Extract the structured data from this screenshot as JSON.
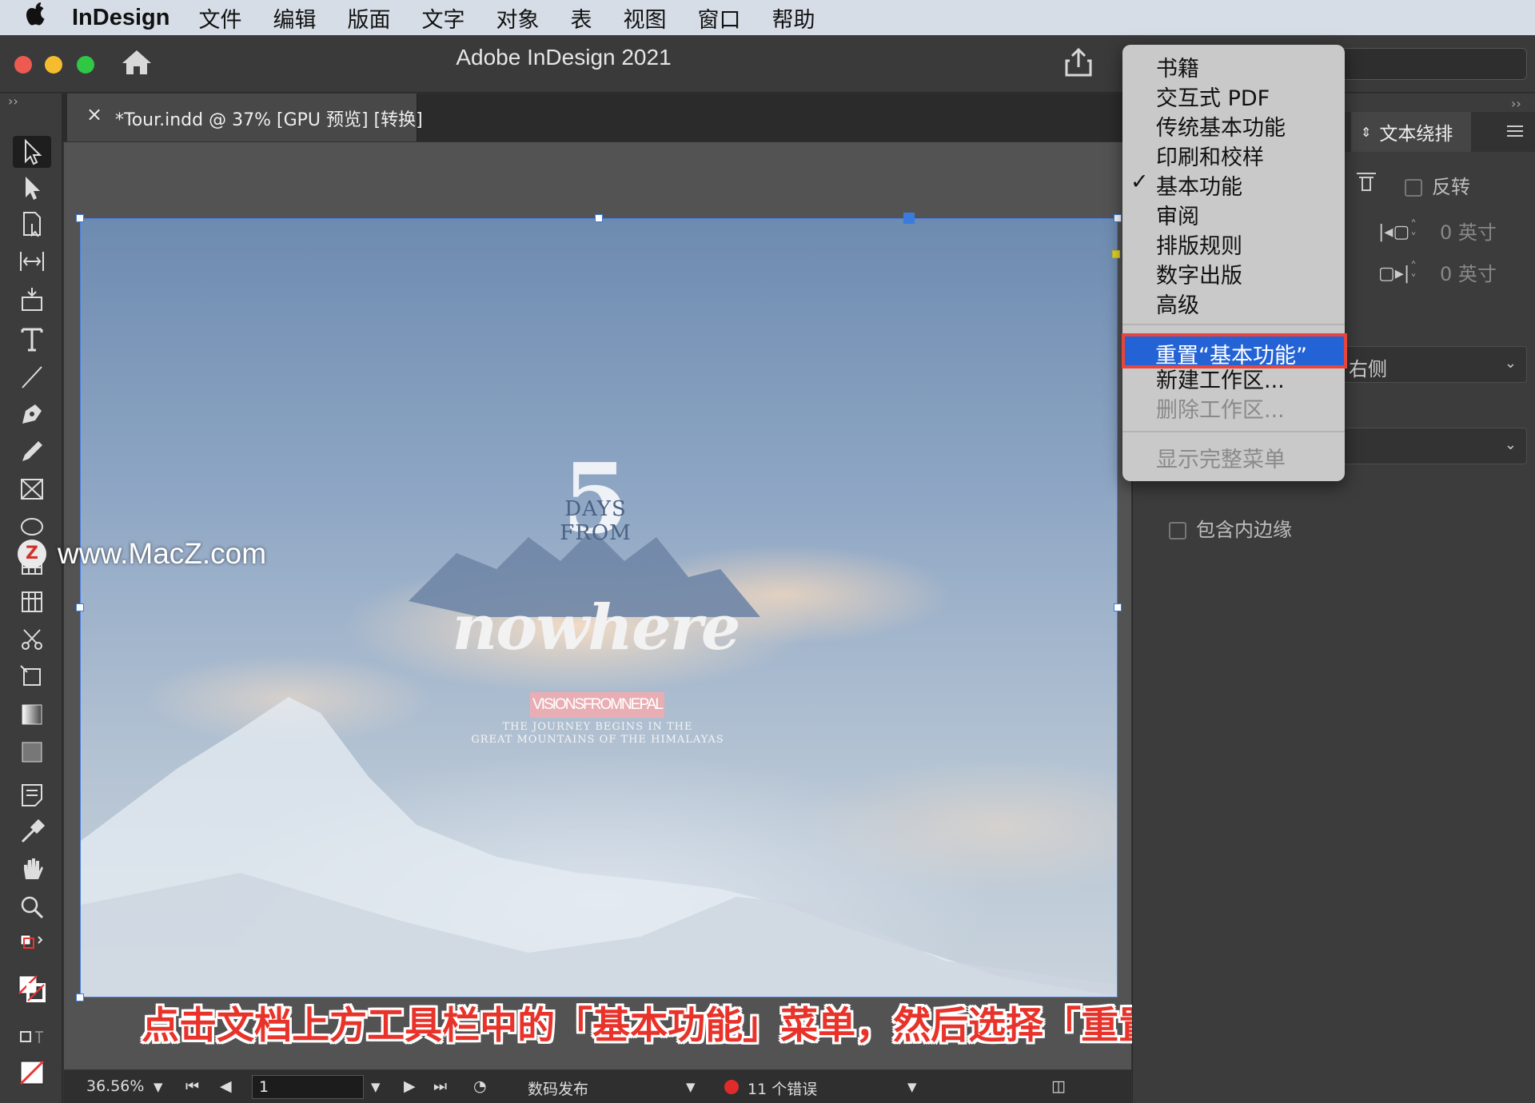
{
  "menubar": {
    "app_name": "InDesign",
    "items": [
      "文件",
      "编辑",
      "版面",
      "文字",
      "对象",
      "表",
      "视图",
      "窗口",
      "帮助"
    ]
  },
  "window": {
    "title": "Adobe InDesign 2021"
  },
  "document_tab": {
    "close": "×",
    "label": "*Tour.indd @ 37% [GPU 预览] [转换]"
  },
  "poster": {
    "days_from": "DAYS FROM",
    "number": "5",
    "title": "nowhere",
    "tag": "VISIONSFROMNEPAL",
    "line1": "THE JOURNEY BEGINS IN THE",
    "line2": "GREAT MOUNTAINS OF THE HIMALAYAS"
  },
  "watermark": {
    "logo": "Z",
    "text": "www.MacZ.com"
  },
  "caption": "点击文档上方工具栏中的「基本功能」菜单，然后选择「重置“基本功能”」",
  "statusbar": {
    "zoom": "36.56%",
    "page": "1",
    "profile": "数码发布",
    "errors": "11 个错误",
    "error_color": "#e02b2b"
  },
  "right_panel": {
    "tab_label": "文本绕排",
    "invert_label": "反转",
    "offset_top": "0 英寸",
    "offset_bottom": "0 英寸",
    "wrap_side_fragment": "右侧",
    "include_inset_label": "包含内边缘"
  },
  "workspace_menu": {
    "items": [
      "书籍",
      "交互式 PDF",
      "传统基本功能",
      "印刷和校样",
      "基本功能",
      "审阅",
      "排版规则",
      "数字出版",
      "高级"
    ],
    "checked_item": "基本功能",
    "check_mark": "✓",
    "reset_item": "重置“基本功能”",
    "new_workspace": "新建工作区...",
    "delete_workspace": "删除工作区...",
    "show_full_menus": "显示完整菜单",
    "highlight_color": "#2463d6",
    "annotation_color": "#e8453c"
  },
  "collapse_glyph": "››"
}
